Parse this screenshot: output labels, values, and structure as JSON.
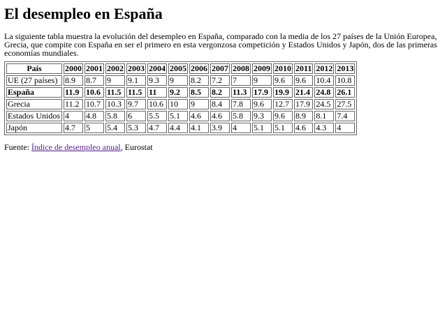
{
  "title": "El desempleo en España",
  "intro": "La siguiente tabla muestra la evolución del desempleo en España, comparado con la media de los 27 países de la Unión Europea, Grecia, que compite con España en ser el primero en esta vergonzosa competición y Estados Unidos y Japón, dos de las primeras economías mundiales.",
  "table": {
    "headers": [
      "País",
      "2000",
      "2001",
      "2002",
      "2003",
      "2004",
      "2005",
      "2006",
      "2007",
      "2008",
      "2009",
      "2010",
      "2011",
      "2012",
      "2013"
    ],
    "rows": [
      {
        "country": "UE (27 países)",
        "bold": false,
        "values": [
          "8.9",
          "8.7",
          "9",
          "9.1",
          "9.3",
          "9",
          "8.2",
          "7.2",
          "7",
          "9",
          "9.6",
          "9.6",
          "10.4",
          "10.8"
        ]
      },
      {
        "country": "España",
        "bold": true,
        "values": [
          "11.9",
          "10.6",
          "11.5",
          "11.5",
          "11",
          "9.2",
          "8.5",
          "8.2",
          "11.3",
          "17.9",
          "19.9",
          "21.4",
          "24.8",
          "26.1"
        ]
      },
      {
        "country": "Grecia",
        "bold": false,
        "values": [
          "11.2",
          "10.7",
          "10.3",
          "9.7",
          "10.6",
          "10",
          "9",
          "8.4",
          "7.8",
          "9.6",
          "12.7",
          "17.9",
          "24.5",
          "27.5"
        ]
      },
      {
        "country": "Estados Unidos",
        "bold": false,
        "values": [
          "4",
          "4.8",
          "5.8",
          "6",
          "5.5",
          "5.1",
          "4.6",
          "4.6",
          "5.8",
          "9.3",
          "9.6",
          "8.9",
          "8.1",
          "7.4"
        ]
      },
      {
        "country": "Japón",
        "bold": false,
        "values": [
          "4.7",
          "5",
          "5.4",
          "5.3",
          "4.7",
          "4.4",
          "4.1",
          "3.9",
          "4",
          "5.1",
          "5.1",
          "4.6",
          "4.3",
          "4"
        ]
      }
    ]
  },
  "source": {
    "prefix": "Fuente: ",
    "link_text": "Índice de desempleo anual",
    "suffix": ", Eurostat"
  }
}
